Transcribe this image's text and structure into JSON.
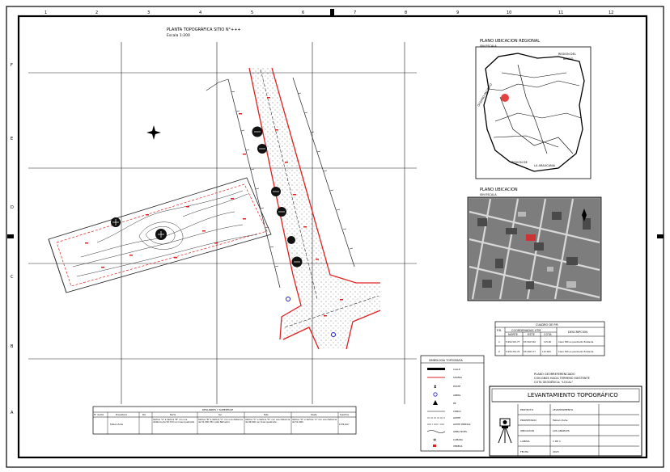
{
  "plan": {
    "title": "PLANTA TOPOGRÁFICA SITIO N°+++",
    "scale": "Escala 1:200"
  },
  "regional": {
    "title": "PLANO UBICACION REGIONAL",
    "subtitle": "SIN ESCALA",
    "labels": [
      "REGION DEL",
      "BIOBIO",
      "OCEANO PACIFICO",
      "REGION DE",
      "LA ARAUCANIA"
    ]
  },
  "ubicacion": {
    "title": "PLANO UBICACION",
    "subtitle": "SIN ESCALA"
  },
  "cuadro_pr": {
    "title": "CUADRO DE P.R.",
    "group_header": "COORDENADAS UTM",
    "headers": [
      "P.R.",
      "NORTE",
      "ESTE",
      "COTA",
      "DESCRIPCION"
    ],
    "rows": [
      [
        "1",
        "5.916.321,77",
        "673.627,60",
        "115.00",
        "Clavo Hilti en pavimento Existente"
      ],
      [
        "2",
        "5.916.331,70",
        "673.663,77",
        "115.000",
        "Clavo Hilti en pavimento Existente"
      ]
    ]
  },
  "notes": [
    "PLANO GEORREFERENCIADO",
    "CON GNSS HACIA TERRENO EXISTENTE",
    "COTA GEODÉSICA: \"LOCAL\""
  ],
  "simbologia": {
    "title": "SIMBOLOGIA TOPOGRAFIA",
    "items": [
      "CALLE",
      "SOLERA",
      "POSTE",
      "ARBOL",
      "PR",
      "CERCO",
      "LIMITE",
      "LIMITE PREDIAL",
      "LINEA NIVEL",
      "CAMARA",
      "VEREDA"
    ]
  },
  "deslindes": {
    "title": "DESLINDES Y SUPERFICIE",
    "headers": [
      "N° de Rol",
      "Propietario",
      "Rol",
      "Norte",
      "Sur",
      "Este",
      "Oeste",
      "Superficie"
    ],
    "row": [
      "",
      "Fabian Zuñe",
      "",
      "Vértice \"A\" a Vértice \"B\" con una distancia de 93.72m en linea quebrada",
      "Vértice \"B\" a Vértice \"C\" con una distancia de 51.00m Pto calle Nahuelco",
      "Vértice \"C\" a Vértice \"D\" con una distancia de 99.00m en linea quebrada",
      "Vértice \"D\" a Vértice \"A\" con una distancia de 51.00m",
      "4.876,00m²"
    ]
  },
  "title_block": {
    "main": "LEVANTAMIENTO TOPOGRÁFICO",
    "sub": "",
    "rows": [
      [
        "PROYECTO",
        "LEVANTAMIENTO"
      ],
      [
        "PROPIETARIO",
        "Fabian Zuñe"
      ],
      [
        "UBICACION",
        "LOS ANGELES"
      ],
      [
        "LAMINA",
        "1 DE 1"
      ],
      [
        "FECHA",
        "2023"
      ]
    ]
  },
  "grid_labels": {
    "top": [
      "1",
      "2",
      "3",
      "4",
      "5",
      "6",
      "7",
      "8",
      "9",
      "10",
      "11",
      "12"
    ],
    "left": [
      "F",
      "E",
      "D",
      "C",
      "B",
      "A"
    ]
  },
  "colors": {
    "boundary": "#e02020",
    "trees": "#111111",
    "markers": "#1a1ad0",
    "ink": "#000000"
  }
}
